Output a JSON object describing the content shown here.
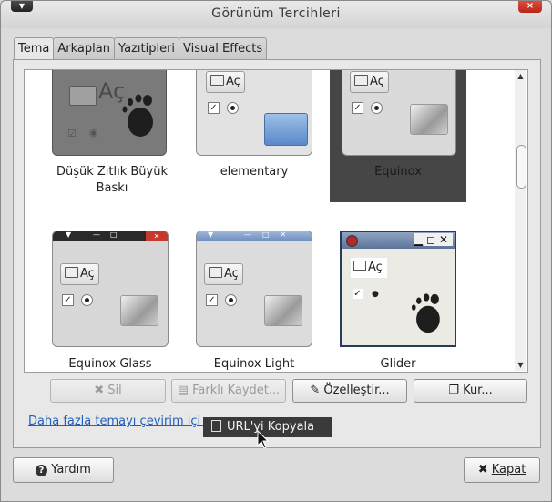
{
  "window": {
    "title": "Görünüm Tercihleri"
  },
  "tabs": [
    {
      "label": "Tema",
      "active": true
    },
    {
      "label": "Arkaplan",
      "active": false
    },
    {
      "label": "Yazıtipleri",
      "active": false
    },
    {
      "label": "Visual Effects",
      "active": false
    }
  ],
  "themes": [
    {
      "name": "Düşük Zıtlık Büyük Baskı",
      "open_label": "Aç"
    },
    {
      "name": "elementary",
      "open_label": "Aç"
    },
    {
      "name": "Equinox",
      "open_label": "Aç",
      "selected": true
    },
    {
      "name": "Equinox Glass",
      "open_label": "Aç"
    },
    {
      "name": "Equinox Light",
      "open_label": "Aç"
    },
    {
      "name": "Glider",
      "open_label": "Aç"
    }
  ],
  "actions": {
    "delete": "Sil",
    "save_as": "Farklı Kaydet...",
    "customize": "Özelleştir...",
    "install": "Kur..."
  },
  "link_text": "Daha fazla temayı çevirim içi a",
  "context_menu": {
    "copy_url": "URL'yi Kopyala"
  },
  "footer": {
    "help": "Yardım",
    "close": "Kapat"
  },
  "colors": {
    "selection": "#464646",
    "link": "#1f5fbf",
    "close_button": "#c8392b"
  }
}
